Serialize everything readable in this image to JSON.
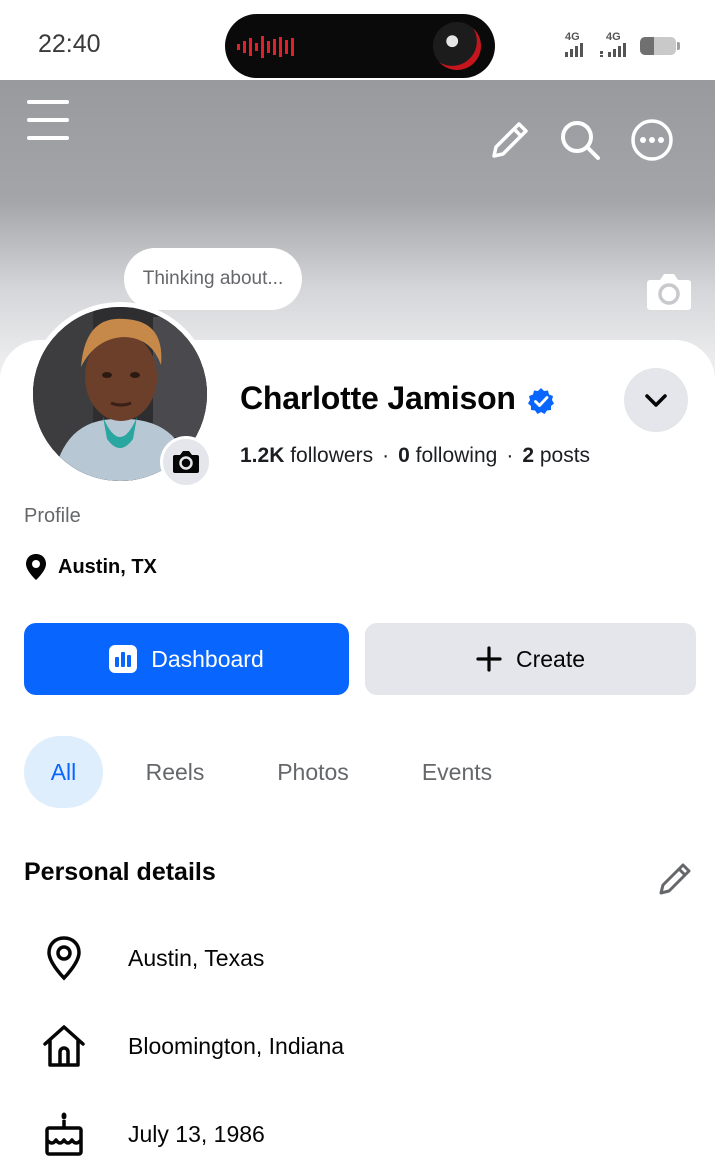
{
  "status_bar": {
    "time": "22:40",
    "network1": "4G",
    "network2": "4G"
  },
  "header_icons": [
    "menu-icon",
    "pencil-icon",
    "search-icon",
    "more-icon",
    "camera-icon"
  ],
  "thought_bubble": "Thinking about...",
  "profile": {
    "name": "Charlotte Jamison",
    "verified": true,
    "followers_count": "1.2K",
    "followers_label": "followers",
    "following_count": "0",
    "following_label": "following",
    "posts_count": "2",
    "posts_label": "posts",
    "category": "Profile",
    "location": "Austin, TX"
  },
  "actions": {
    "dashboard": "Dashboard",
    "create": "Create"
  },
  "tabs": [
    {
      "label": "All",
      "active": true
    },
    {
      "label": "Reels",
      "active": false
    },
    {
      "label": "Photos",
      "active": false
    },
    {
      "label": "Events",
      "active": false
    }
  ],
  "personal_details": {
    "title": "Personal details",
    "items": [
      {
        "icon": "location-pin-icon",
        "text": "Austin, Texas"
      },
      {
        "icon": "home-icon",
        "text": "Bloomington, Indiana"
      },
      {
        "icon": "birthday-cake-icon",
        "text": "July 13, 1986"
      }
    ]
  },
  "colors": {
    "primary": "#0866ff",
    "secondary_button": "#e4e6eb",
    "active_tab_bg": "#dfeefc",
    "muted_text": "#65676b"
  }
}
